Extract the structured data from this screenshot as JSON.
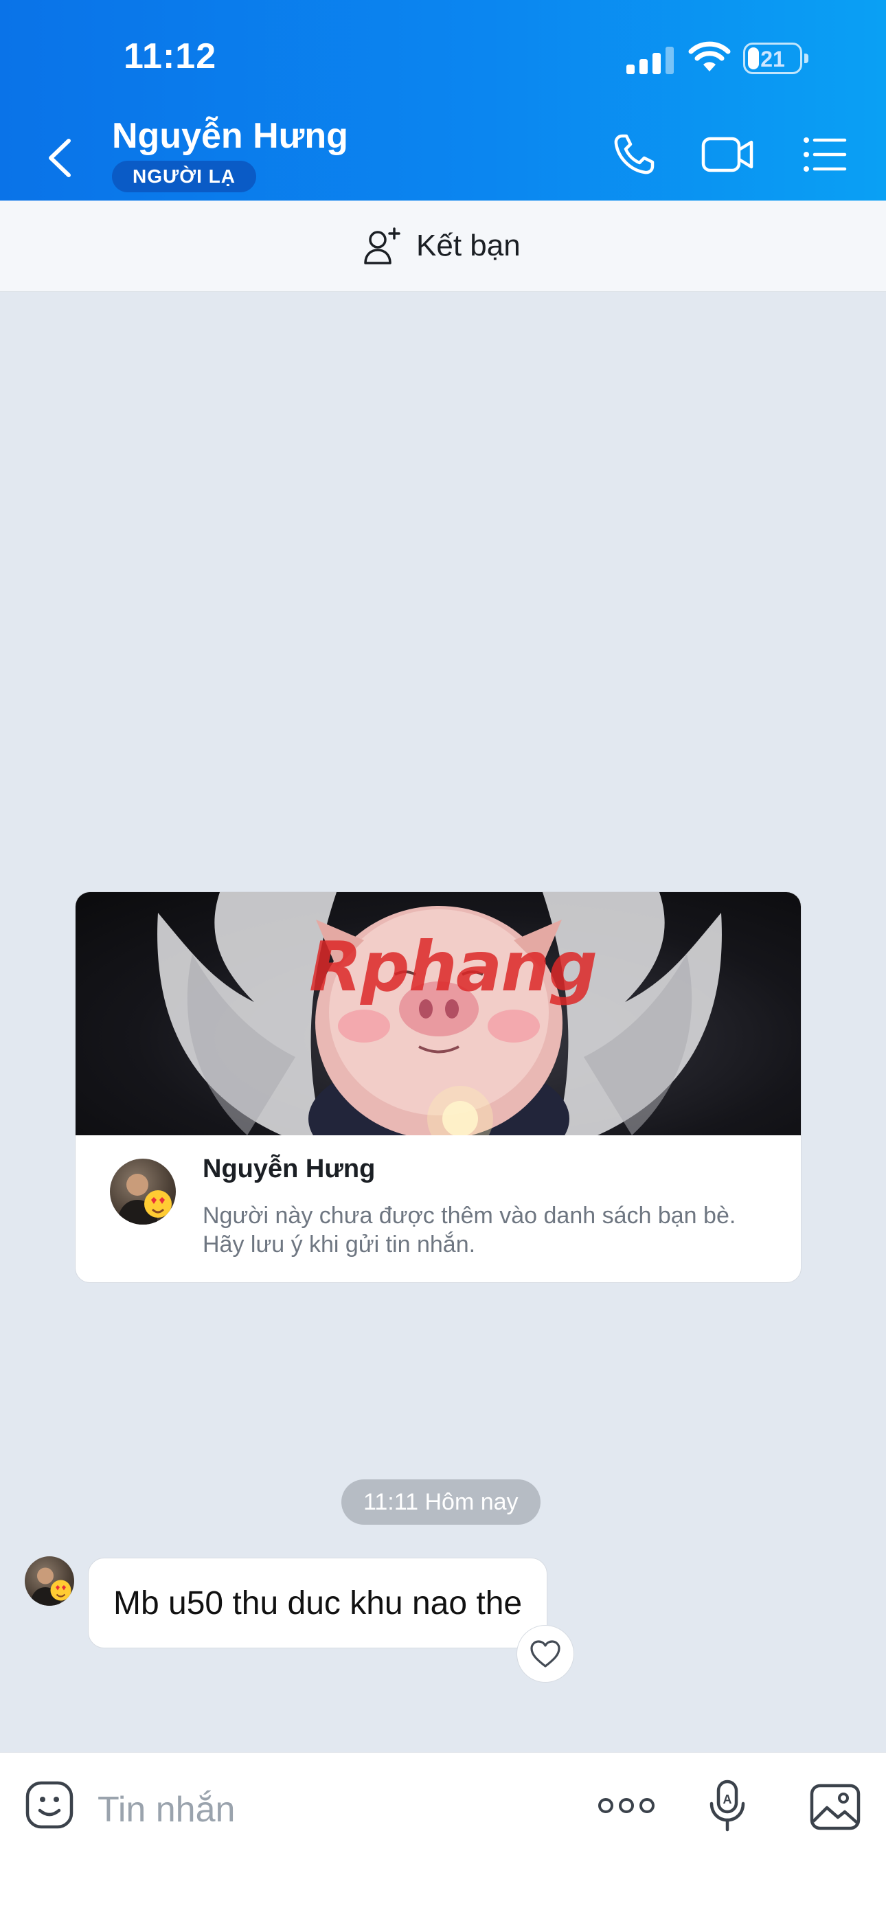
{
  "status_bar": {
    "time": "11:12",
    "battery": 21
  },
  "header": {
    "title": "Nguyễn Hưng",
    "badge": "NGƯỜI LẠ",
    "icons": [
      "back-icon",
      "phone-icon",
      "video-icon",
      "menu-list-icon"
    ]
  },
  "add_friend": {
    "label": "Kết bạn",
    "icon": "add-user-icon"
  },
  "profile_card": {
    "watermark": "Rphang",
    "name": "Nguyễn Hưng",
    "description": "Người này chưa được thêm vào danh sách bạn bè. Hãy lưu ý khi gửi tin nhắn."
  },
  "messages": {
    "timestamp": "11:11 Hôm nay",
    "items": [
      {
        "text": "Mb u50 thu duc khu nao the"
      }
    ]
  },
  "composer": {
    "placeholder": "Tin nhắn",
    "icons": [
      "sticker-icon",
      "more-icon",
      "voice-icon",
      "image-icon"
    ]
  },
  "colors": {
    "header_start": "#0a73e8",
    "header_end": "#0aa0f4",
    "chat_background": "#e2e8f0",
    "badge": "#0a5bc6"
  }
}
